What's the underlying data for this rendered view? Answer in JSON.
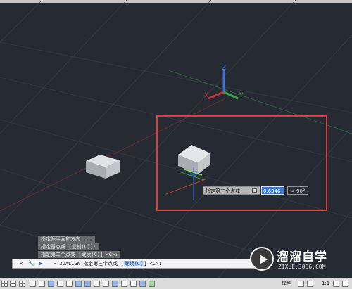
{
  "viewport": {
    "axis_labels": {
      "z": "Z",
      "x": "X",
      "y": "Y"
    },
    "colors": {
      "background": "#262a33",
      "highlight_box": "#e03c3c",
      "cube_face": "#b9bcc0",
      "red_axis": "#c03a3a",
      "green_axis": "#3aa64a",
      "blue_axis": "#3d6fe0"
    }
  },
  "dynamic_input": {
    "prompt_label": "指定第三个点或",
    "value": "0.6346",
    "angle": "< 90°"
  },
  "command_history": [
    "指定源平面和方向 ...",
    "指定基点或 [复制(C)]:",
    "指定第二个点或 [继续(C)] <C>:"
  ],
  "command_line": {
    "close_icon": "✕",
    "wrench_icon": "🔧",
    "prompt_icon": "▶",
    "prefix": "- 3DALIGN 指定第三个点或 [",
    "option": "继续(C)",
    "suffix": "] <C>:"
  },
  "statusbar": {
    "model_tab": "模型",
    "scale": "1:1"
  },
  "watermark": {
    "title": "溜溜自学",
    "subtitle": "ZIXUE.3066.COM"
  }
}
